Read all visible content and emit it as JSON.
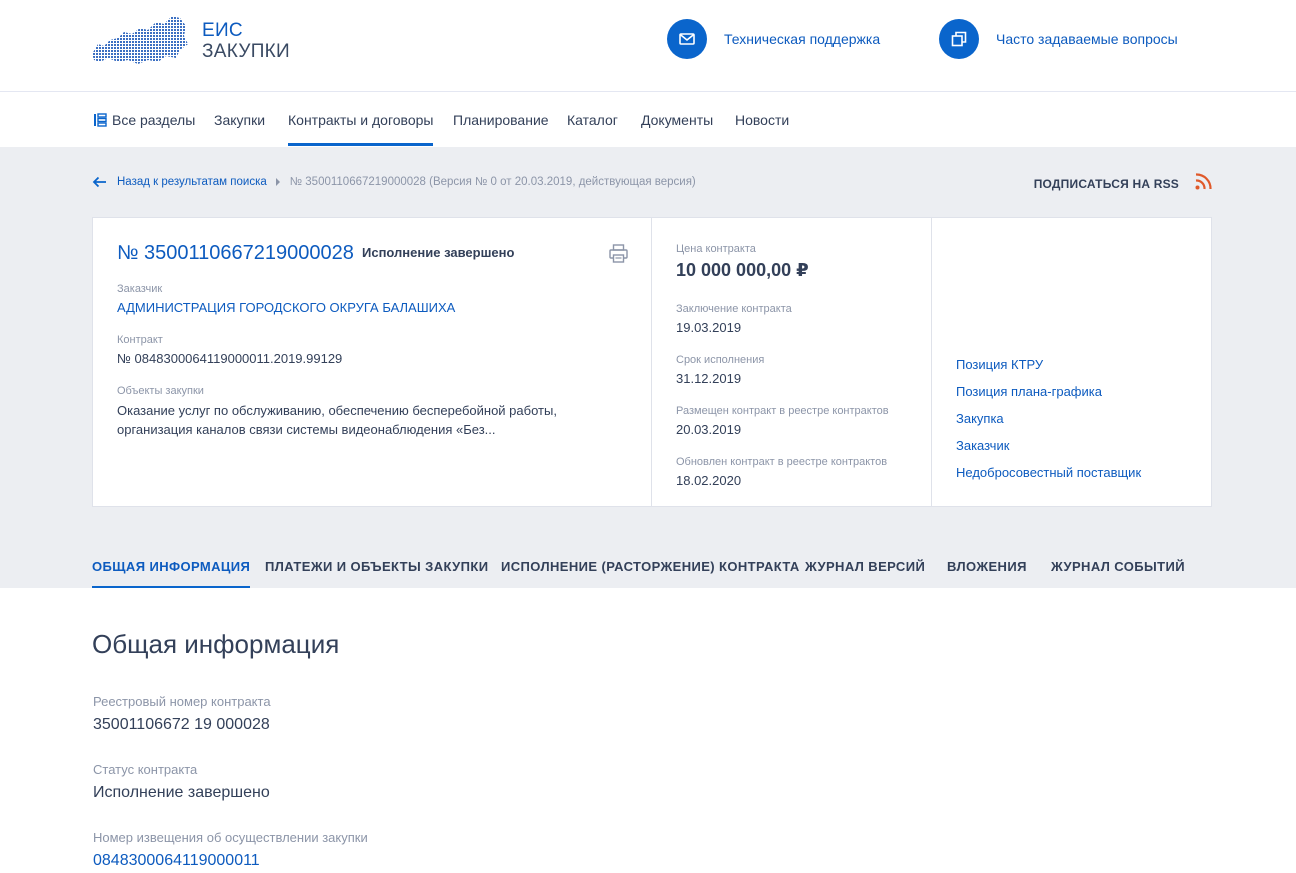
{
  "header": {
    "logo_line1": "ЕИС",
    "logo_line2": "ЗАКУПКИ",
    "support_label": "Техническая поддержка",
    "faq_label": "Часто задаваемые вопросы"
  },
  "nav": {
    "items": [
      {
        "label": "Все разделы"
      },
      {
        "label": "Закупки"
      },
      {
        "label": "Контракты и договоры"
      },
      {
        "label": "Планирование"
      },
      {
        "label": "Каталог"
      },
      {
        "label": "Документы"
      },
      {
        "label": "Новости"
      }
    ],
    "active": "Контракты и договоры"
  },
  "breadcrumb": {
    "back": "Назад к результатам поиска",
    "current": "№ 3500110667219000028 (Версия № 0 от 20.03.2019, действующая версия)"
  },
  "rss_label": "ПОДПИСАТЬСЯ НА RSS",
  "card": {
    "number": "№ 3500110667219000028",
    "status": "Исполнение завершено",
    "customer_label": "Заказчик",
    "customer": "АДМИНИСТРАЦИЯ ГОРОДСКОГО ОКРУГА БАЛАШИХА",
    "contract_label": "Контракт",
    "contract": "№ 0848300064119000011.2019.99129",
    "objects_label": "Объекты закупки",
    "objects": "Оказание услуг по обслуживанию, обеспечению бесперебойной работы, организация каналов связи системы видеонаблюдения «Без...",
    "price_label": "Цена контракта",
    "price": "10 000 000,00 ₽",
    "conclusion_label": "Заключение контракта",
    "conclusion": "19.03.2019",
    "deadline_label": "Срок исполнения",
    "deadline": "31.12.2019",
    "placed_label": "Размещен контракт в реестре контрактов",
    "placed": "20.03.2019",
    "updated_label": "Обновлен контракт в реестре контрактов",
    "updated": "18.02.2020",
    "links": [
      "Позиция КТРУ",
      "Позиция плана-графика",
      "Закупка",
      "Заказчик",
      "Недобросовестный поставщик"
    ]
  },
  "tabs": [
    {
      "label": "ОБЩАЯ ИНФОРМАЦИЯ"
    },
    {
      "label": "ПЛАТЕЖИ И ОБЪЕКТЫ ЗАКУПКИ"
    },
    {
      "label": "ИСПОЛНЕНИЕ (РАСТОРЖЕНИЕ) КОНТРАКТА"
    },
    {
      "label": "ЖУРНАЛ ВЕРСИЙ"
    },
    {
      "label": "ВЛОЖЕНИЯ"
    },
    {
      "label": "ЖУРНАЛ СОБЫТИЙ"
    }
  ],
  "main": {
    "title": "Общая информация",
    "registry_label": "Реестровый номер контракта",
    "registry": "35001106672 19 000028",
    "status_label": "Статус контракта",
    "status": "Исполнение завершено",
    "notice_label": "Номер извещения об осуществлении закупки",
    "notice": "0848300064119000011"
  },
  "colors": {
    "accent": "#0a65cc",
    "link": "#0d5bbf",
    "text": "#334059",
    "muted": "#8c95a8",
    "band": "#eceef2",
    "rss": "#e0592a"
  }
}
